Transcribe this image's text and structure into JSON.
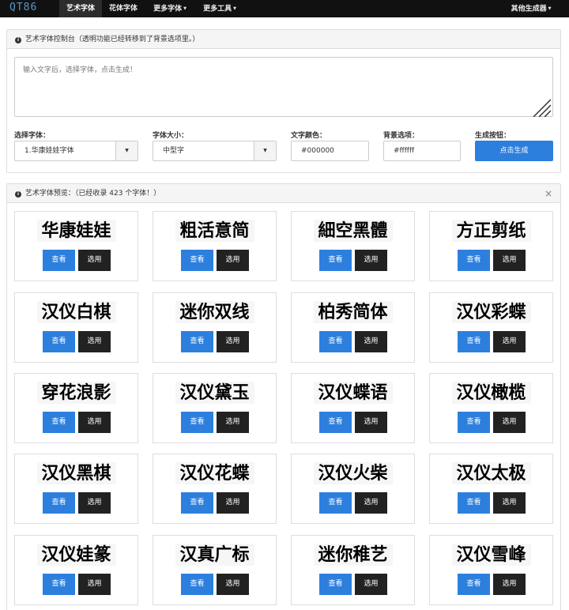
{
  "nav": {
    "logo": "QT86",
    "items": [
      {
        "label": "艺术字体",
        "active": true
      },
      {
        "label": "花体字体",
        "active": false
      },
      {
        "label": "更多字体",
        "active": false
      },
      {
        "label": "更多工具",
        "active": false
      }
    ],
    "right": "其他生成器"
  },
  "control_panel": {
    "title": "艺术字体控制台（透明功能已经转移到了背景选项里。）",
    "textarea_placeholder": "输入文字后，选择字体，点击生成！",
    "fields": {
      "font_label": "选择字体：",
      "font_value": "1.华康娃娃字体",
      "size_label": "字体大小：",
      "size_value": "中型字",
      "color_label": "文字颜色：",
      "color_value": "#000000",
      "bg_label": "背景选项：",
      "bg_value": "#ffffff",
      "gen_label": "生成按钮：",
      "gen_button": "点击生成"
    }
  },
  "preview_panel": {
    "title": "艺术字体预览：（已经收录 423 个字体！）",
    "close": "×",
    "view_label": "查看",
    "select_label": "选用",
    "fonts": [
      "华康娃娃",
      "粗活意简",
      "細空黑體",
      "方正剪纸",
      "汉仪白棋",
      "迷你双线",
      "柏秀简体",
      "汉仪彩蝶",
      "穿花浪影",
      "汉仪黛玉",
      "汉仪蝶语",
      "汉仪橄榄",
      "汉仪黑棋",
      "汉仪花蝶",
      "汉仪火柴",
      "汉仪太极",
      "汉仪娃篆",
      "汉真广标",
      "迷你稚艺",
      "汉仪雪峰"
    ]
  }
}
